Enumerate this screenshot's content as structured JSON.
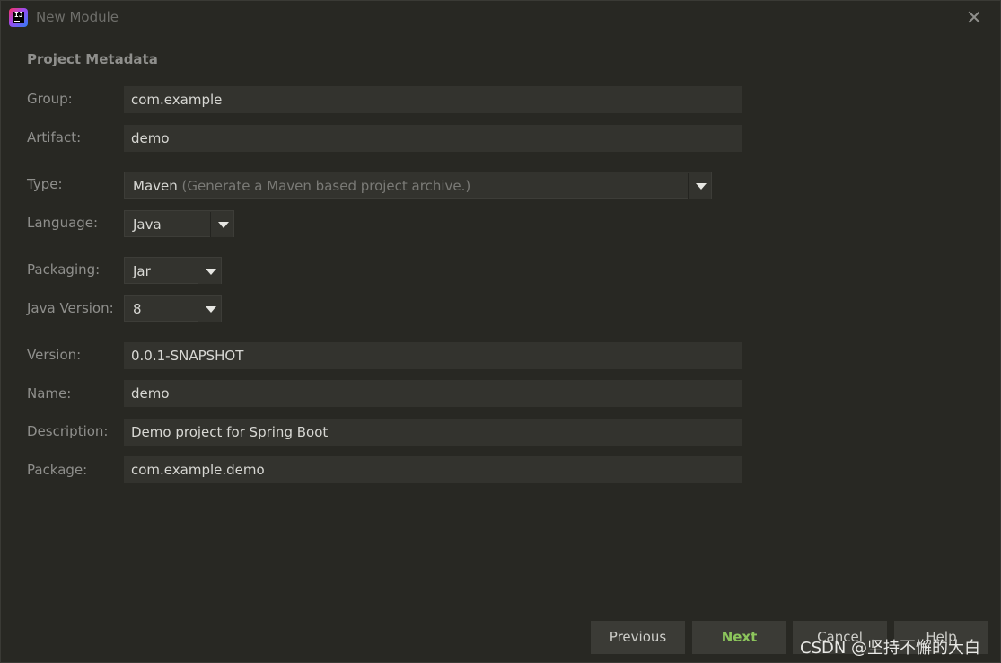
{
  "window": {
    "title": "New Module"
  },
  "section": {
    "title": "Project Metadata"
  },
  "form": {
    "group": {
      "label": "Group:",
      "value": "com.example"
    },
    "artifact": {
      "label": "Artifact:",
      "value": "demo"
    },
    "type": {
      "label": "Type:",
      "value": "Maven",
      "hint": "(Generate a Maven based project archive.)"
    },
    "language": {
      "label": "Language:",
      "value": "Java"
    },
    "packaging": {
      "label": "Packaging:",
      "value": "Jar"
    },
    "java_version": {
      "label": "Java Version:",
      "value": "8"
    },
    "version": {
      "label": "Version:",
      "value": "0.0.1-SNAPSHOT"
    },
    "name": {
      "label": "Name:",
      "value": "demo"
    },
    "description": {
      "label": "Description:",
      "value": "Demo project for Spring Boot"
    },
    "package": {
      "label": "Package:",
      "value": "com.example.demo"
    }
  },
  "buttons": {
    "previous": "Previous",
    "next": "Next",
    "cancel": "Cancel",
    "help": "Help"
  },
  "watermark": "CSDN @坚持不懈的大白",
  "icons": {
    "app": "intellij-idea-icon",
    "close": "close-icon",
    "dropdown": "chevron-down-icon"
  },
  "colors": {
    "background": "#282823",
    "field": "#33332e",
    "accent": "#8cc55c"
  }
}
